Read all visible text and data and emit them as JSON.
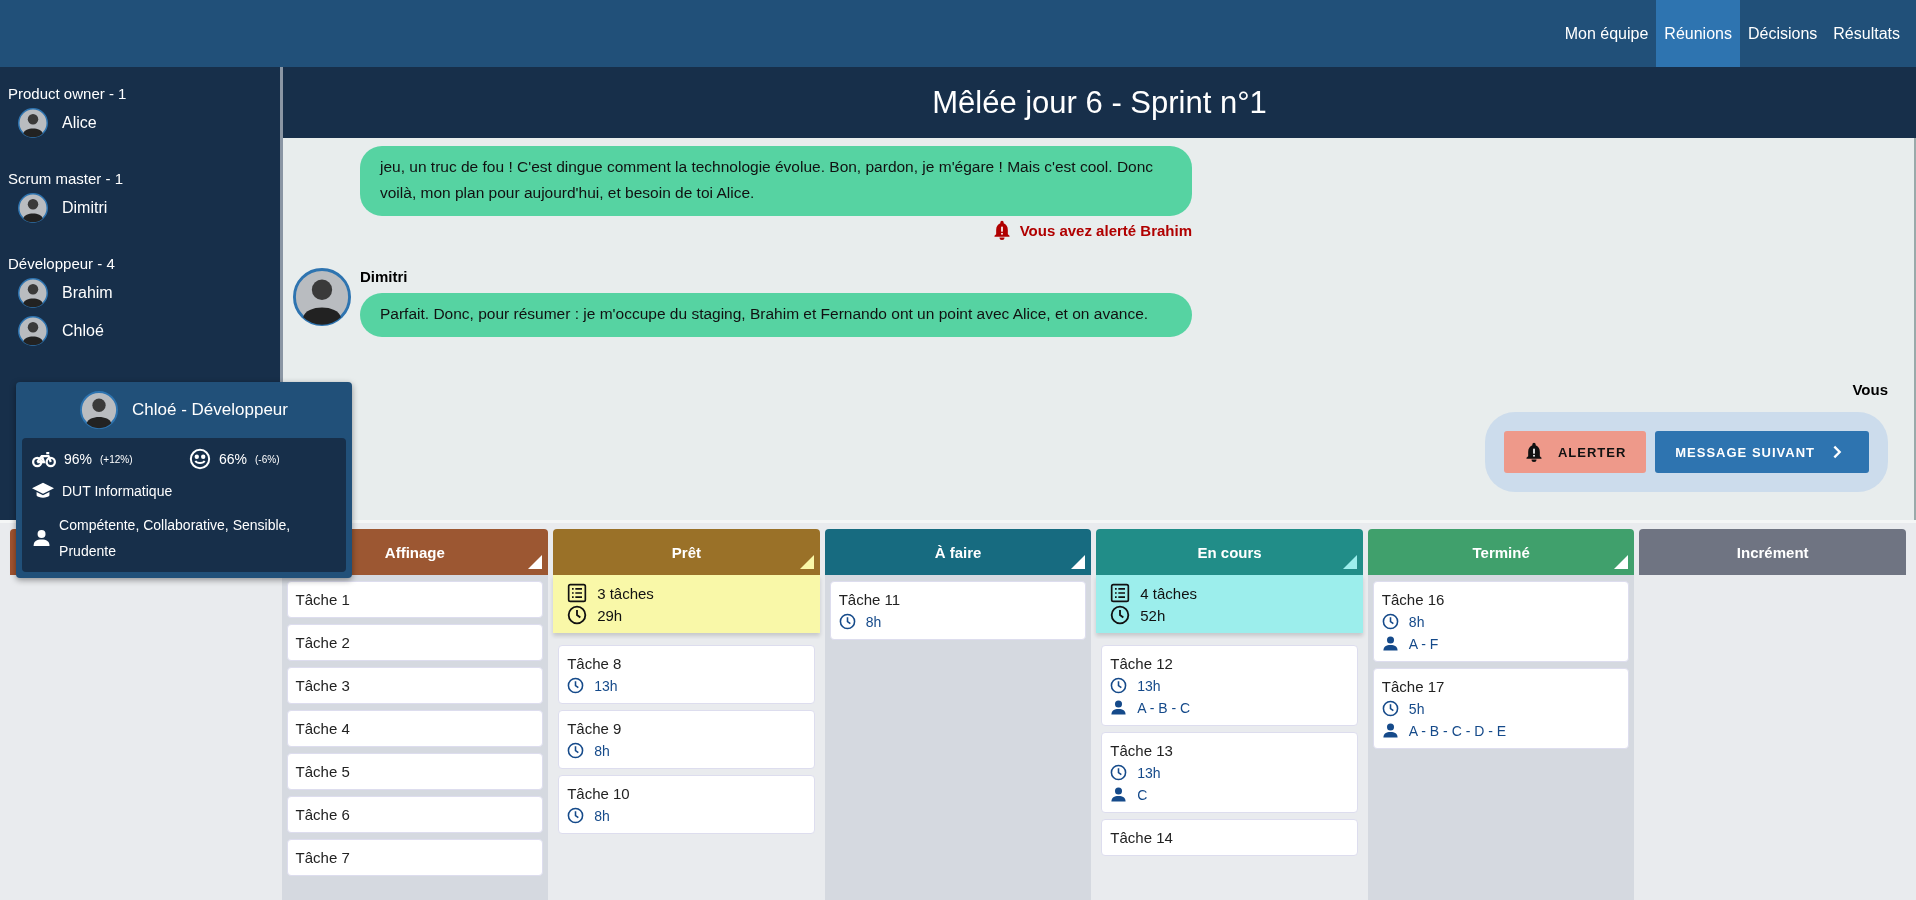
{
  "nav": {
    "items": [
      {
        "label": "Mon équipe",
        "selected": false
      },
      {
        "label": "Réunions",
        "selected": true
      },
      {
        "label": "Décisions",
        "selected": false
      },
      {
        "label": "Résultats",
        "selected": false
      }
    ]
  },
  "sidebar": {
    "groups": [
      {
        "title": "Product owner - 1",
        "members": [
          "Alice"
        ]
      },
      {
        "title": "Scrum master - 1",
        "members": [
          "Dimitri"
        ]
      },
      {
        "title": "Développeur - 4",
        "members": [
          "Brahim",
          "Chloé"
        ]
      }
    ]
  },
  "meeting": {
    "title": "Mêlée jour 6 - Sprint n°1"
  },
  "chat": {
    "messages": [
      {
        "text": "jeu, un truc de fou ! C'est dingue comment la technologie évolue. Bon, pardon, je m'égare ! Mais c'est cool. Donc voilà, mon plan pour aujourd'hui, et besoin de toi Alice.",
        "alert": "Vous avez alerté Brahim"
      },
      {
        "sender": "Dimitri",
        "text": "Parfait. Donc, pour résumer : je m'occupe du staging, Brahim et Fernando ont un point avec Alice, et on avance."
      }
    ],
    "you": "Vous",
    "actions": [
      {
        "kind": "alert",
        "label": "ALERTER"
      },
      {
        "kind": "next",
        "label": "MESSAGE SUIVANT"
      }
    ]
  },
  "board": {
    "columns": [
      {
        "color": "#a0532f"
      },
      {
        "title": "Affinage",
        "color": "#9c5732",
        "corner": true,
        "tasks": [
          {
            "title": "Tâche 1"
          },
          {
            "title": "Tâche 2"
          },
          {
            "title": "Tâche 3"
          },
          {
            "title": "Tâche 4"
          },
          {
            "title": "Tâche 5"
          },
          {
            "title": "Tâche 6"
          },
          {
            "title": "Tâche 7"
          }
        ]
      },
      {
        "title": "Prêt",
        "color": "#9a7128",
        "corner": true,
        "summary": {
          "count": "3 tâches",
          "hours": "29h",
          "color": "#f9f8a8"
        },
        "tasks": [
          {
            "title": "Tâche 8",
            "hours": "13h"
          },
          {
            "title": "Tâche 9",
            "hours": "8h"
          },
          {
            "title": "Tâche 10",
            "hours": "8h"
          }
        ]
      },
      {
        "title": "À faire",
        "color": "#176b80",
        "corner": true,
        "tasks": [
          {
            "title": "Tâche 11",
            "hours": "8h"
          }
        ]
      },
      {
        "title": "En cours",
        "color": "#218d88",
        "corner": true,
        "summary": {
          "count": "4 tâches",
          "hours": "52h",
          "color": "#9ceeec"
        },
        "tasks": [
          {
            "title": "Tâche 12",
            "hours": "13h",
            "people": "A - B - C"
          },
          {
            "title": "Tâche 13",
            "hours": "13h",
            "people": "C"
          },
          {
            "title": "Tâche 14"
          }
        ]
      },
      {
        "title": "Terminé",
        "color": "#40a06c",
        "corner": true,
        "tasks": [
          {
            "title": "Tâche 16",
            "hours": "8h",
            "people": "A - F"
          },
          {
            "title": "Tâche 17",
            "hours": "5h",
            "people": "A - B - C - D - E"
          }
        ]
      },
      {
        "title": "Incrément",
        "color": "#6f7482",
        "corner": false
      }
    ]
  },
  "tooltip": {
    "title": "Chloé - Développeur",
    "motivation": "96%",
    "motivation_change": "(+12%)",
    "mood": "66%",
    "mood_change": "(-6%)",
    "education": "DUT Informatique",
    "traits": "Compétente, Collaborative, Sensible, Prudente"
  }
}
